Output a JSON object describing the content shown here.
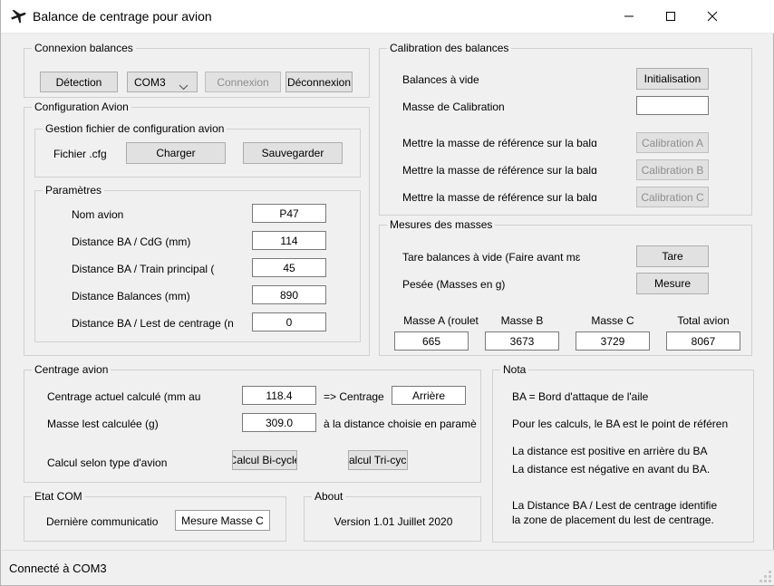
{
  "window": {
    "title": "Balance de centrage pour avion",
    "icon": "airplane-icon",
    "minimize_label": "—",
    "maximize_label": "□",
    "close_label": "✕"
  },
  "connexion_balances": {
    "legend": "Connexion balances",
    "detection_button": "Détection",
    "port_combo_value": "COM3",
    "connexion_button": "Connexion",
    "deconnexion_button": "Déconnexion"
  },
  "configuration_avion": {
    "legend": "Configuration Avion",
    "gestion": {
      "legend": "Gestion fichier de configuration avion",
      "fichier_label": "Fichier .cfg",
      "charger_button": "Charger",
      "sauvegarder_button": "Sauvegarder"
    },
    "parametres": {
      "legend": "Paramètres",
      "rows": [
        {
          "label": "Nom avion",
          "value": "P47"
        },
        {
          "label": "Distance BA / CdG (mm)",
          "value": "114"
        },
        {
          "label": "Distance BA / Train principal (",
          "value": "45"
        },
        {
          "label": "Distance Balances (mm)",
          "value": "890"
        },
        {
          "label": "Distance BA / Lest de centrage (n",
          "value": "0"
        }
      ]
    }
  },
  "calibration": {
    "legend": "Calibration des balances",
    "balances_vide_label": "Balances à vide",
    "initialisation_button": "Initialisation",
    "masse_calibration_label": "Masse de Calibration",
    "masse_calibration_value": "",
    "rows": [
      {
        "label": "Mettre la masse de référence sur la balɑ",
        "button": "Calibration A"
      },
      {
        "label": "Mettre la masse de référence sur la balɑ",
        "button": "Calibration B"
      },
      {
        "label": "Mettre la masse de référence sur la balɑ",
        "button": "Calibration C"
      }
    ]
  },
  "mesures": {
    "legend": "Mesures des masses",
    "tare_label": "Tare balances à vide (Faire avant mɛ",
    "tare_button": "Tare",
    "pesee_label": "Pesée (Masses en g)",
    "mesure_button": "Mesure",
    "masses": [
      {
        "header": "Masse A (roulet",
        "value": "665"
      },
      {
        "header": "Masse B",
        "value": "3673"
      },
      {
        "header": "Masse C",
        "value": "3729"
      },
      {
        "header": "Total avion",
        "value": "8067"
      }
    ]
  },
  "centrage": {
    "legend": "Centrage avion",
    "centrage_actuel_label": "Centrage actuel calculé (mm au",
    "centrage_actuel_value": "118.4",
    "centrage_arrow_text": "=> Centrage",
    "centrage_type_value": "Arrière",
    "masse_lest_label": "Masse lest calculée (g)",
    "masse_lest_value": "309.0",
    "masse_lest_note": "à la distance choisie en paramè",
    "calcul_type_label": "Calcul selon type d'avion",
    "calcul_bicycle_button": "Calcul Bi-cycle",
    "calcul_tricycle_button": "Calcul Tri-cycle"
  },
  "nota": {
    "legend": "Nota",
    "lines": [
      "BA = Bord d'attaque de l'aile",
      "Pour les calculs, le BA est le  point de référen",
      "La distance est positive en arrière du BA",
      "La distance est négative en avant du BA.",
      "La Distance BA / Lest de centrage identifie",
      "la zone de placement du lest de centrage."
    ]
  },
  "etat_com": {
    "legend": "Etat COM",
    "derniere_label": "Dernière communicatio",
    "derniere_value": "Mesure Masse C"
  },
  "about": {
    "legend": "About",
    "version": "Version 1.01  Juillet 2020"
  },
  "statusbar": {
    "text": "Connecté à COM3"
  }
}
